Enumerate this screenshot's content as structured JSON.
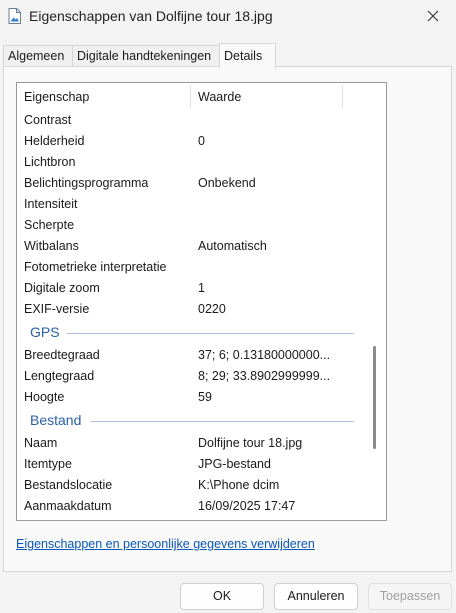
{
  "window": {
    "title": "Eigenschappen van Dolfijne tour 18.jpg"
  },
  "tabs": [
    {
      "label": "Algemeen"
    },
    {
      "label": "Digitale handtekeningen"
    },
    {
      "label": "Details"
    }
  ],
  "table": {
    "header": {
      "property": "Eigenschap",
      "value": "Waarde"
    },
    "rows": [
      {
        "k": "Contrast",
        "v": ""
      },
      {
        "k": "Helderheid",
        "v": "0"
      },
      {
        "k": "Lichtbron",
        "v": ""
      },
      {
        "k": "Belichtingsprogramma",
        "v": "Onbekend"
      },
      {
        "k": "Intensiteit",
        "v": ""
      },
      {
        "k": "Scherpte",
        "v": ""
      },
      {
        "k": "Witbalans",
        "v": "Automatisch"
      },
      {
        "k": "Fotometrieke interpretatie",
        "v": ""
      },
      {
        "k": "Digitale zoom",
        "v": "1"
      },
      {
        "k": "EXIF-versie",
        "v": "0220"
      },
      {
        "group": "GPS"
      },
      {
        "k": "Breedtegraad",
        "v": "37; 6; 0.13180000000..."
      },
      {
        "k": "Lengtegraad",
        "v": "8; 29; 33.8902999999..."
      },
      {
        "k": "Hoogte",
        "v": "59"
      },
      {
        "group": "Bestand"
      },
      {
        "k": "Naam",
        "v": "Dolfijne tour 18.jpg"
      },
      {
        "k": "Itemtype",
        "v": "JPG-bestand"
      },
      {
        "k": "Bestandslocatie",
        "v": "K:\\Phone dcim"
      },
      {
        "k": "Aanmaakdatum",
        "v": "16/09/2025 17:47"
      }
    ]
  },
  "remove_link": "Eigenschappen en persoonlijke gegevens verwijderen",
  "buttons": {
    "ok": "OK",
    "cancel": "Annuleren",
    "apply": "Toepassen"
  },
  "colors": {
    "accent": "#2a5fa8",
    "link": "#0a58b8"
  },
  "icons": {
    "title": "image-file-icon",
    "close": "close-icon"
  }
}
